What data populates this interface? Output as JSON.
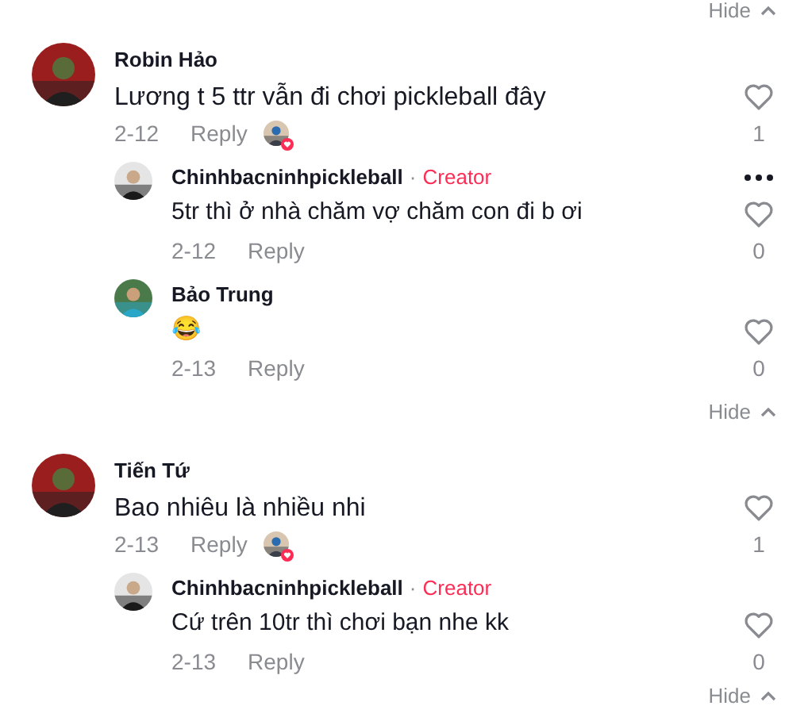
{
  "top_hide": {
    "label": "Hide"
  },
  "threads": [
    {
      "author": "Robin Hảo",
      "text": "Lương t 5 ttr vẫn đi chơi pickleball đây",
      "date": "2-12",
      "reply": "Reply",
      "liked_by_creator": true,
      "likes": "1",
      "hide": "Hide",
      "replies": [
        {
          "author": "Chinhbacninhpickleball",
          "separator": "·",
          "badge": "Creator",
          "text": "5tr thì ở nhà chăm vợ chăm con đi b ơi",
          "date": "2-12",
          "reply": "Reply",
          "likes": "0",
          "has_menu": true
        },
        {
          "author": "Bảo Trung",
          "text": "😂",
          "date": "2-13",
          "reply": "Reply",
          "likes": "0",
          "has_menu": false
        }
      ]
    },
    {
      "author": "Tiến Tứ",
      "text": "Bao nhiêu là nhiều nhi",
      "date": "2-13",
      "reply": "Reply",
      "liked_by_creator": true,
      "likes": "1",
      "hide": "Hide",
      "replies": [
        {
          "author": "Chinhbacninhpickleball",
          "separator": "·",
          "badge": "Creator",
          "text": "Cứ trên 10tr thì chơi bạn nhe kk",
          "date": "2-13",
          "reply": "Reply",
          "likes": "0",
          "has_menu": false
        }
      ]
    }
  ]
}
